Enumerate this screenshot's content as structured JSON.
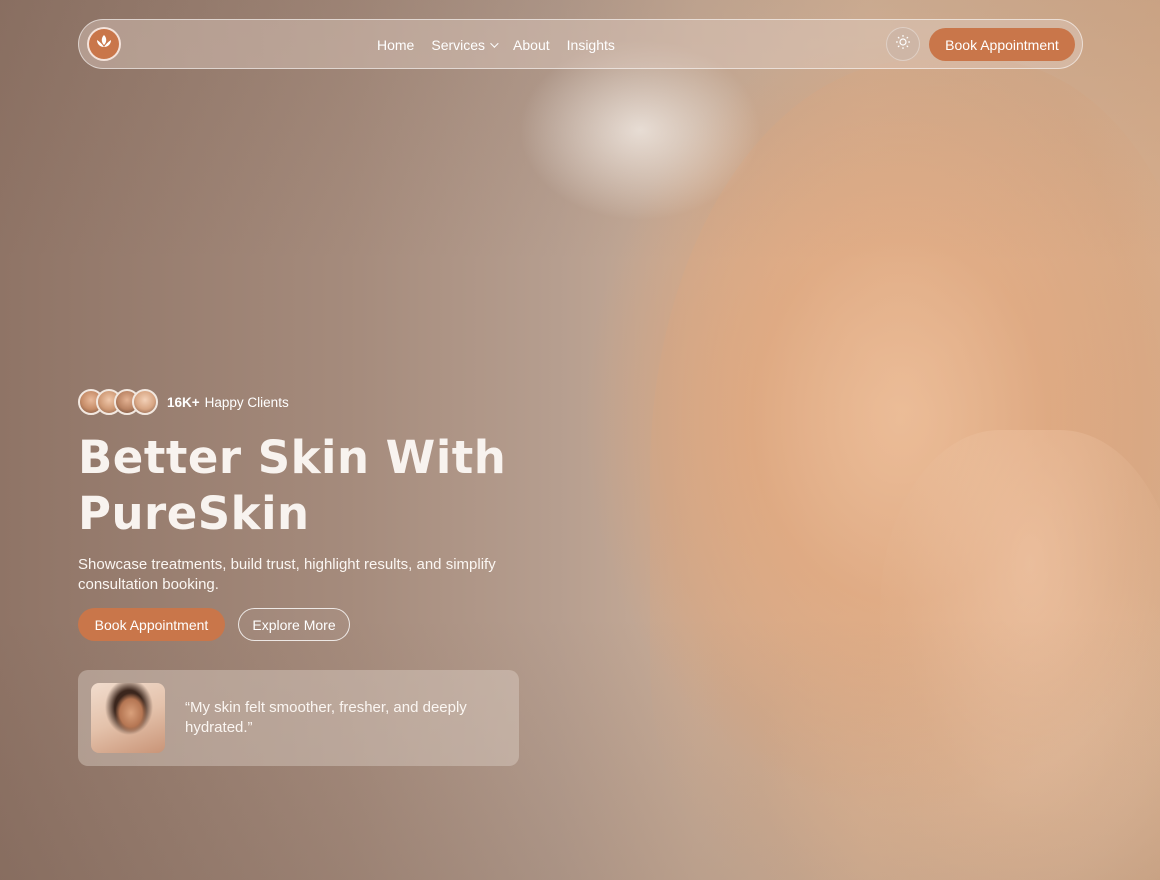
{
  "nav": {
    "links": [
      {
        "label": "Home"
      },
      {
        "label": "Services"
      },
      {
        "label": "About"
      },
      {
        "label": "Insights"
      }
    ],
    "cta_label": "Book Appointment",
    "theme_icon": "sun-icon",
    "logo_icon": "lotus-leaf-icon"
  },
  "hero": {
    "clients_count": "16K+",
    "clients_label": "Happy Clients",
    "headline_line1": "Better Skin With",
    "headline_line2": "PureSkin",
    "subtitle": "Showcase treatments, build trust, highlight results, and simplify consultation booking.",
    "primary_button": "Book Appointment",
    "secondary_button": "Explore More"
  },
  "testimonial": {
    "quote": "“My skin felt smoother, fresher, and deeply hydrated.”"
  },
  "colors": {
    "accent": "#c9764a",
    "text": "#ffffff"
  }
}
